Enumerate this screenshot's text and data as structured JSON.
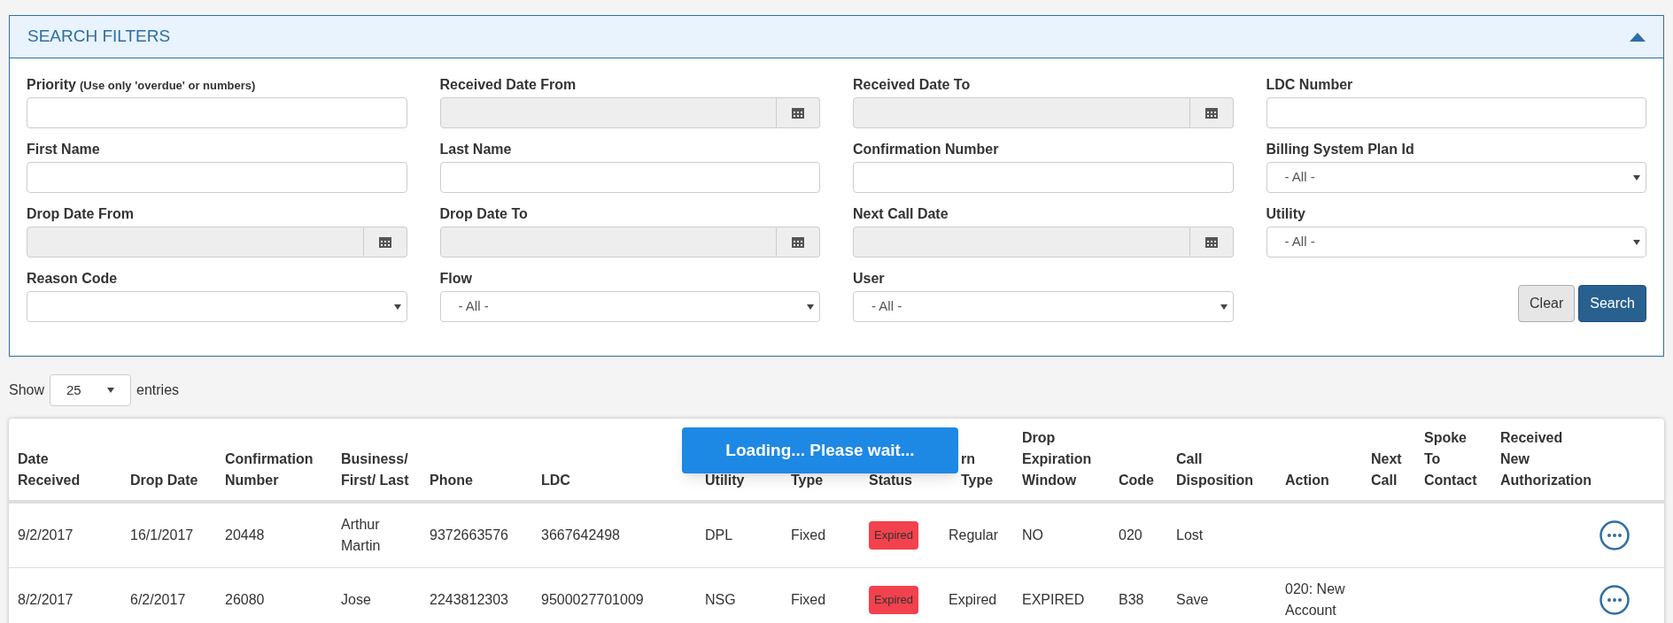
{
  "filters": {
    "title": "SEARCH FILTERS",
    "fields": [
      {
        "kind": "text",
        "label": "Priority",
        "hint": "(Use only 'overdue' or numbers)"
      },
      {
        "kind": "date",
        "label": "Received Date From"
      },
      {
        "kind": "date",
        "label": "Received Date To"
      },
      {
        "kind": "text",
        "label": "LDC Number"
      },
      {
        "kind": "text",
        "label": "First Name"
      },
      {
        "kind": "text",
        "label": "Last Name"
      },
      {
        "kind": "text",
        "label": "Confirmation Number"
      },
      {
        "kind": "select",
        "label": "Billing System Plan Id",
        "value": "- All -"
      },
      {
        "kind": "date",
        "label": "Drop Date From"
      },
      {
        "kind": "date",
        "label": "Drop Date To"
      },
      {
        "kind": "date",
        "label": "Next Call Date"
      },
      {
        "kind": "select",
        "label": "Utility",
        "value": "- All -"
      },
      {
        "kind": "select",
        "label": "Reason Code"
      },
      {
        "kind": "select",
        "label": "Flow",
        "value": "- All -"
      },
      {
        "kind": "select",
        "label": "User",
        "value": "- All -"
      }
    ],
    "buttons": [
      {
        "label": "Clear",
        "kind": "default"
      },
      {
        "label": "Search",
        "kind": "primary"
      }
    ]
  },
  "length": {
    "before": "Show",
    "value": "25",
    "after": "entries"
  },
  "loading": "Loading... Please wait...",
  "table": {
    "columns": [
      {
        "lines": [
          "Date",
          "Received"
        ]
      },
      {
        "lines": [
          "Drop Date"
        ]
      },
      {
        "lines": [
          "Confirmation",
          "Number"
        ]
      },
      {
        "lines": [
          "Business/",
          "First/ Last"
        ]
      },
      {
        "lines": [
          "Phone"
        ]
      },
      {
        "lines": [
          "LDC"
        ]
      },
      {
        "lines": [
          "Utility"
        ]
      },
      {
        "lines": [
          "Type"
        ]
      },
      {
        "lines": [
          "Status"
        ]
      },
      {
        "lines": [
          "rn",
          "Type"
        ]
      },
      {
        "lines": [
          "Drop",
          "Expiration",
          "Window"
        ]
      },
      {
        "lines": [
          "Code"
        ]
      },
      {
        "lines": [
          "Call",
          "Disposition"
        ]
      },
      {
        "lines": [
          "Action"
        ]
      },
      {
        "lines": [
          "Next",
          "Call"
        ]
      },
      {
        "lines": [
          "Spoke",
          "To",
          "Contact"
        ]
      },
      {
        "lines": [
          "Received",
          "New",
          "Authorization"
        ]
      }
    ],
    "rows": [
      {
        "cells": [
          "9/2/2017",
          "16/1/2017",
          "20448",
          "Arthur Martin",
          "9372663576",
          "3667642498",
          "DPL",
          "Fixed",
          "Expired",
          "Regular",
          "NO",
          "020",
          "Lost",
          "",
          "",
          "",
          ""
        ]
      },
      {
        "cells": [
          "8/2/2017",
          "6/2/2017",
          "26080",
          "Jose",
          "2243812303",
          "9500027701009",
          "NSG",
          "Fixed",
          "Expired",
          "Expired",
          "EXPIRED",
          "B38",
          "Save",
          "020: New Account",
          "",
          "",
          ""
        ]
      }
    ]
  }
}
